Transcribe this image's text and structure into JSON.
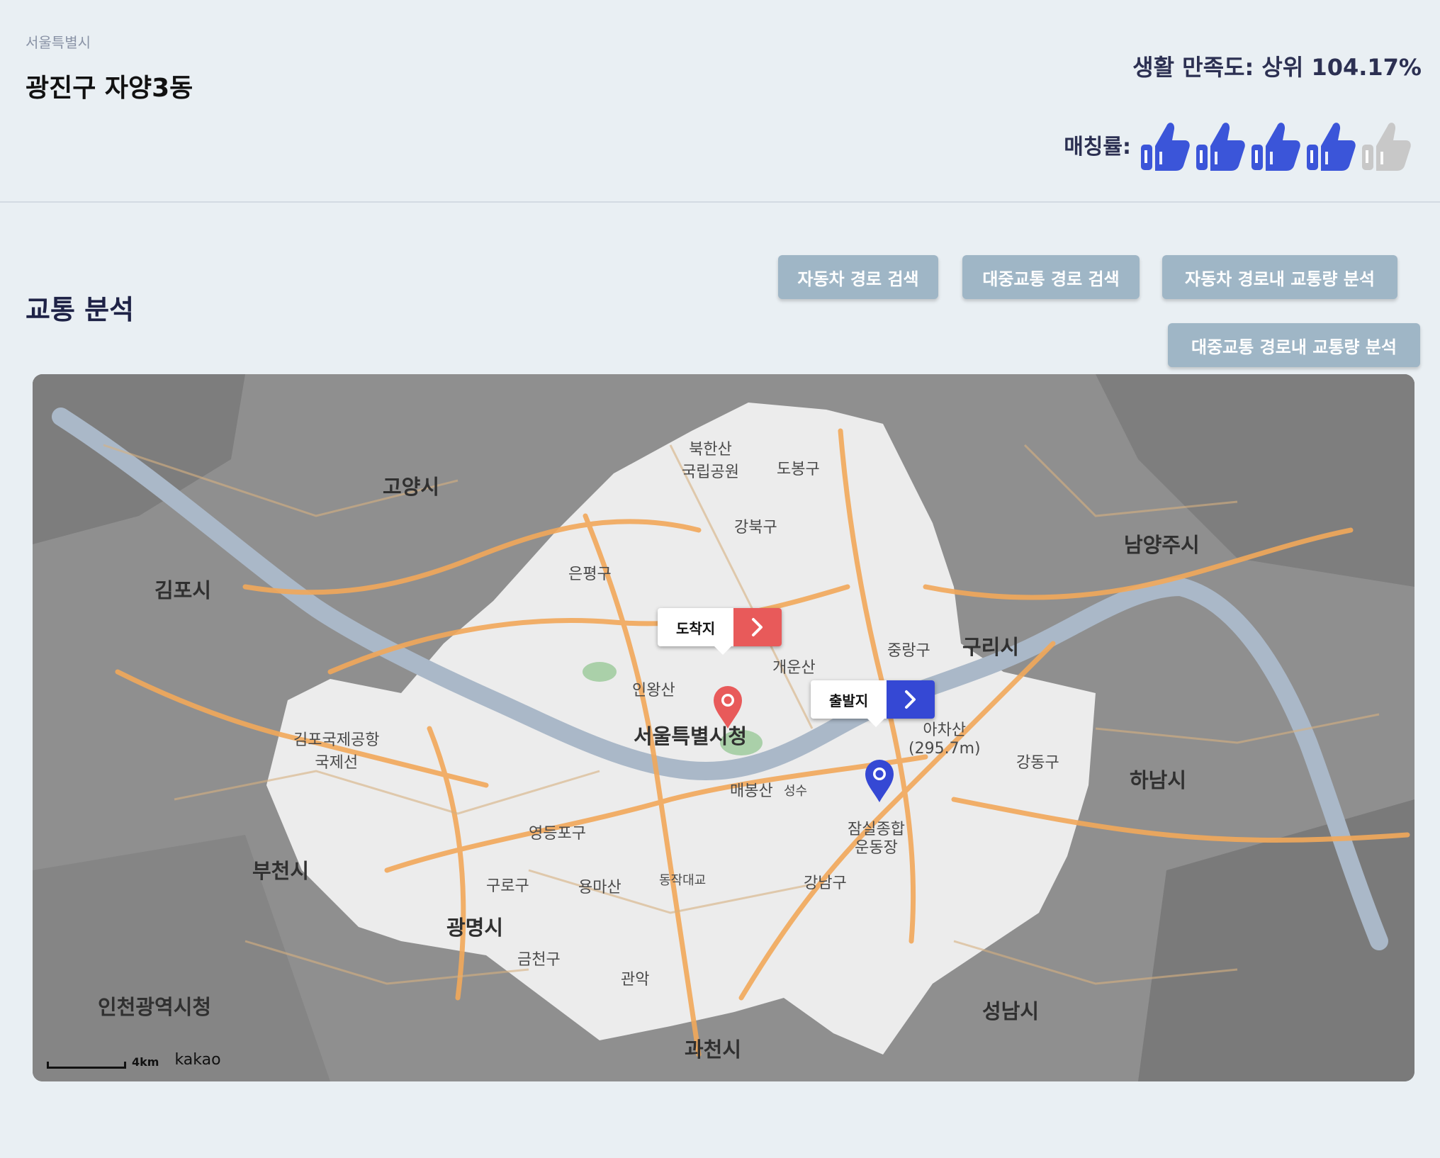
{
  "header": {
    "region": "서울특별시",
    "district": "광진구 자양3동",
    "satisfaction": "생활 만족도: 상위 104.17%",
    "matching_label": "매칭률:",
    "matching_rating": 4,
    "matching_max": 5,
    "colors": {
      "active": "#3b55d9",
      "inactive": "#c8c8c8"
    }
  },
  "traffic": {
    "title": "교통 분석",
    "buttons": {
      "car_route": "자동차 경로 검색",
      "transit_route": "대중교통 경로 검색",
      "car_traffic": "자동차 경로내 교통량 분석",
      "transit_traffic": "대중교통 경로내 교통량 분석"
    }
  },
  "map": {
    "destination": {
      "label": "도착지",
      "color": "#e85a5a",
      "icon": "chevron-right-icon"
    },
    "origin": {
      "label": "출발지",
      "color": "#3548d4",
      "icon": "chevron-right-icon"
    },
    "scale": "4km",
    "attribution": "kakao",
    "labels": {
      "seoul_city_hall": "서울특별시청",
      "gimpo_city": "김포시",
      "goyang_city": "고양시",
      "bucheon_city": "부천시",
      "gwangmyeong_city": "광명시",
      "guri_city": "구리시",
      "hanam_city": "하남시",
      "seongnam_city": "성남시",
      "gwacheon_city": "과천시",
      "namyangju_city": "남양주시",
      "incheon_city_hall": "인천광역시청",
      "gimpo_airport": "김포국제공항\n국제선",
      "bukhansan": "북한산\n국립공원",
      "gangnam_gu": "강남구",
      "gangdong_gu": "강동구",
      "seocho_gu": "관악",
      "guro_gu": "구로구",
      "geumcheon_gu": "금천구",
      "yeongdeungpo_gu": "영등포구",
      "eunpyeong_gu": "은평구",
      "gangbuk_gu": "강북구",
      "jungnang_gu": "중랑구",
      "dobong_gu": "도봉구",
      "jamsil": "잠실종합\n운동장",
      "achasan": "아차산\n(295.7m)",
      "yongmasan": "용마산",
      "inwangsan": "인왕산",
      "maebongsan": "매봉산",
      "gaeunsan": "개운산",
      "dongjak_bridge": "동작대교",
      "seongsu": "성수"
    }
  }
}
